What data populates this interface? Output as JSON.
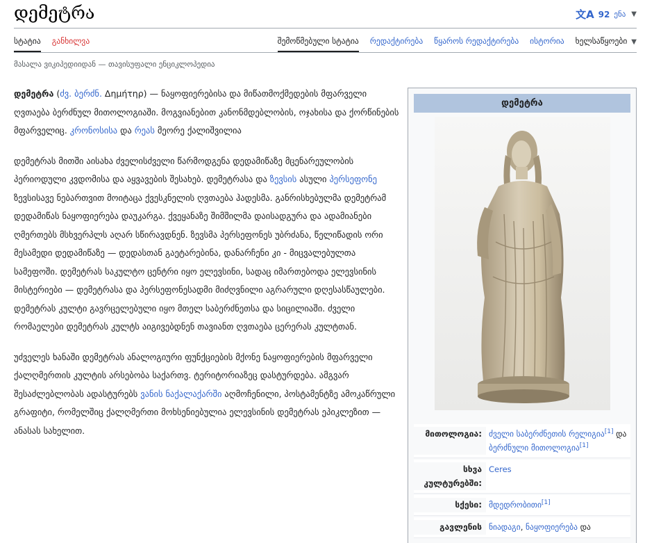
{
  "page": {
    "title": "დემეტრა",
    "tagline": "მასალა ვიკიპედიიდან — თავისუფალი ენციკლოპედია"
  },
  "lang": {
    "icon": "translate-icon",
    "label": "92",
    "suffix": "ენა"
  },
  "tabs_left": [
    {
      "label": "სტატია",
      "selected": true
    },
    {
      "label": "განხილვა",
      "selected": false,
      "red": true
    }
  ],
  "tabs_right": [
    {
      "label": "შემოწმებული სტატია",
      "selected": true
    },
    {
      "label": "რედაქტირება",
      "selected": false
    },
    {
      "label": "წყაროს რედაქტირება",
      "selected": false
    },
    {
      "label": "ისტორია",
      "selected": false
    },
    {
      "label": "ხელსაწყოები",
      "selected": false
    }
  ],
  "paragraphs": {
    "p1": [
      {
        "t": "დემეტრა",
        "b": true
      },
      {
        "t": " ("
      },
      {
        "t": "ძვ. ბერძნ.",
        "link": true
      },
      {
        "t": " Δημήτηρ) — ნაყოფიერებისა და მიწათმოქმედების მფარველი ღვთაება ბერძნულ მითოლოგიაში. მოგვიანებით კანონმდებლობის, ოჯახისა და ქორწინების მფარველიც. "
      },
      {
        "t": "კრონოსისა",
        "link": true
      },
      {
        "t": " და "
      },
      {
        "t": "რეას",
        "link": true
      },
      {
        "t": " მეორე ქალიშვილია"
      }
    ],
    "p2": [
      {
        "t": "დემეტრას მითში აისახა ძველისძველი წარმოდგენა დედამიწაზე მცენარეულობის პერიოდული კვდომისა და აყვავების შესახებ. დემეტრასა და "
      },
      {
        "t": "ზევსის",
        "link": true
      },
      {
        "t": " ასული "
      },
      {
        "t": "პერსეფონე",
        "link": true
      },
      {
        "t": " ზევსისავე ნებართვით მოიტაცა ქვესკნელის ღვთაება ჰადესმა. განრისხებულმა დემეტრამ დედამიწას ნაყოფიერება დაუკარგა. ქვეყანაზე შიმშილმა დაისადგურა და ადამიანები ღმერთებს მსხვერპლს აღარ სწირავდნენ. ზევსმა პერსეფონეს უბრძანა, წელიწადის ორი მესამედი დედამიწაზე — დედასთან გაეტარებინა, დანარჩენი კი - მიცვალებულთა სამეფოში. დემეტრას საკულტო ცენტრი იყო ელევსინი, სადაც იმართებოდა ელევსინის მისტერიები — დემეტრასა და პერსეფონესადმი მიძღვნილი აგრარული დღესასწაულები. დემეტრას კულტი გავრცელებული იყო მთელ საბერძნეთსა და სიცილიაში. ძველი რომაელები დემეტრას კულტს აიგივებდნენ თავიანთ ღვთაება ცერერას კულტთან."
      }
    ],
    "p3": [
      {
        "t": "უძველეს ხანაში დემეტრას ანალოგიური ფუნქციების მქონე ნაყოფიერების მფარველი ქალღმერთის კულტის არსებობა საქართვ. ტერიტორიაზეც დასტურდება. ამგვარ შესაძლებლობას ადასტურებს "
      },
      {
        "t": "ვანის ნაქალაქარში",
        "link": true
      },
      {
        "t": " აღმოჩენილი, პოსტამენტზე ამოკაწრული გრაფიტი, რომელშიც ქალღმერთი მოხსენიებულია ელევსინის დემეტრას ეპიკლეზით — ანასას სახელით."
      }
    ]
  },
  "infobox": {
    "title": "დემეტრა",
    "image_name": "statue-image",
    "rows": [
      {
        "label": "მითოლოგია:",
        "value": [
          {
            "t": "ძველი საბერძნეთის რელიგია",
            "link": true
          },
          {
            "t": "[1]",
            "sup": true,
            "link": true
          },
          {
            "t": " და "
          },
          {
            "t": "ბერძნული მითოლოგია",
            "link": true
          },
          {
            "t": "[1]",
            "sup": true,
            "link": true
          }
        ]
      },
      {
        "label": "სხვა კულტურებში:",
        "value": [
          {
            "t": "Ceres",
            "link": true
          }
        ]
      },
      {
        "label": "სქესი:",
        "value": [
          {
            "t": "მდედრობითი",
            "link": true
          },
          {
            "t": "[1]",
            "sup": true,
            "link": true
          }
        ]
      },
      {
        "label": "გავლენის",
        "value": [
          {
            "t": "ნიადაგი",
            "link": true
          },
          {
            "t": ", "
          },
          {
            "t": "ნაყოფიერება",
            "link": true
          },
          {
            "t": " და"
          }
        ]
      }
    ]
  }
}
